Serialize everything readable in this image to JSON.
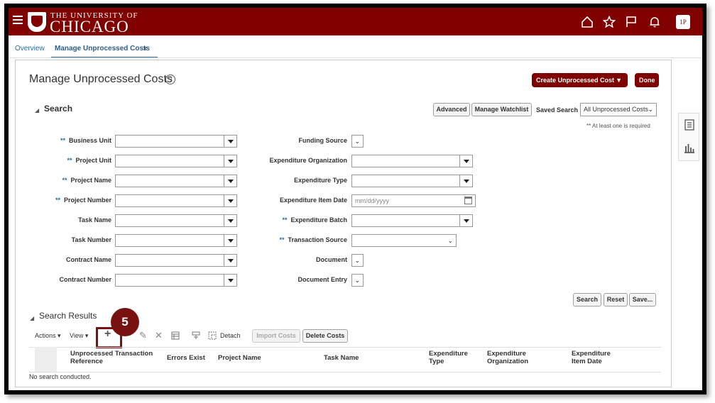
{
  "header": {
    "uni_top": "THE UNIVERSITY OF",
    "uni_main": "CHICAGO",
    "avatar": "1P",
    "brand_color": "#800000"
  },
  "tabs": [
    {
      "label": "Overview"
    },
    {
      "label": "Manage Unprocessed Costs"
    }
  ],
  "tab_close": "×",
  "page": {
    "title": "Manage Unprocessed Costs",
    "help": "?",
    "create_btn": "Create Unprocessed Cost",
    "done_btn": "Done"
  },
  "search": {
    "title": "Search",
    "advanced_btn": "Advanced",
    "watchlist_btn": "Manage Watchlist",
    "saved_label": "Saved Search",
    "saved_value": "All Unprocessed Costs",
    "required_hint": "** At least one is required",
    "req_mark": "**",
    "left_fields": [
      {
        "label": "Business Unit",
        "required": true
      },
      {
        "label": "Project Unit",
        "required": true
      },
      {
        "label": "Project Name",
        "required": true
      },
      {
        "label": "Project Number",
        "required": true
      },
      {
        "label": "Task Name",
        "required": false
      },
      {
        "label": "Task Number",
        "required": false
      },
      {
        "label": "Contract Name",
        "required": false
      },
      {
        "label": "Contract Number",
        "required": false
      }
    ],
    "right_fields": [
      {
        "label": "Funding Source"
      },
      {
        "label": "Expenditure Organization"
      },
      {
        "label": "Expenditure Type"
      },
      {
        "label": "Expenditure Item Date",
        "placeholder": "mm/dd/yyyy"
      },
      {
        "label": "Expenditure Batch"
      },
      {
        "label": "Transaction Source"
      },
      {
        "label": "Document"
      },
      {
        "label": "Document Entry"
      }
    ],
    "search_btn": "Search",
    "reset_btn": "Reset",
    "save_btn": "Save..."
  },
  "results": {
    "title": "Search Results",
    "actions": "Actions",
    "view": "View",
    "detach": "Detach",
    "import_btn": "Import Costs",
    "delete_btn": "Delete Costs",
    "step": "5",
    "columns": [
      "Unprocessed Transaction Reference",
      "Errors Exist",
      "Project Name",
      "Task Name",
      "Expenditure Type",
      "Expenditure Organization",
      "Expenditure Item Date"
    ],
    "empty": "No search conducted."
  }
}
